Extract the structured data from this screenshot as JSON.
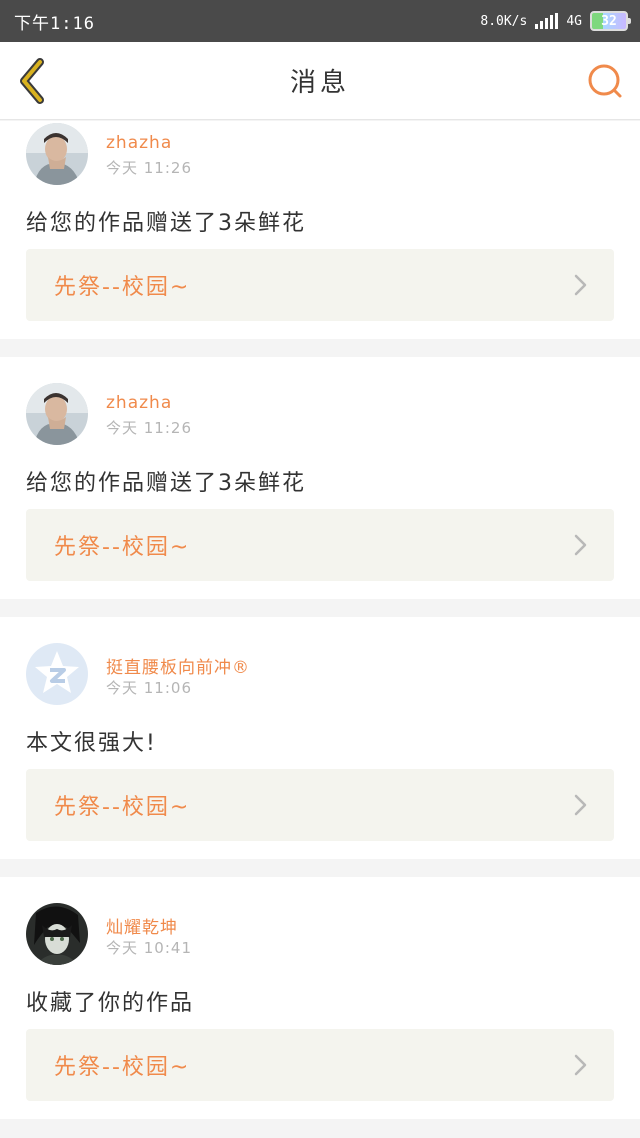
{
  "status_bar": {
    "time": "下午1:16",
    "network_speed": "8.0K/s",
    "network_type": "4G",
    "battery": "32"
  },
  "header": {
    "title": "消息",
    "back_icon": "chevron-left-icon",
    "search_icon": "search-icon"
  },
  "colors": {
    "accent": "#f08a4b",
    "back_icon": "#c9a41a"
  },
  "messages": [
    {
      "username": "zhazha",
      "time": "今天 11:26",
      "text": "给您的作品赠送了3朵鲜花",
      "work_title": "先祭--校园~"
    },
    {
      "username": "zhazha",
      "time": "今天 11:26",
      "text": "给您的作品赠送了3朵鲜花",
      "work_title": "先祭--校园~"
    },
    {
      "username": "挺直腰板向前冲®",
      "time": "今天 11:06",
      "text": "本文很强大!",
      "work_title": "先祭--校园~"
    },
    {
      "username": "灿耀乾坤",
      "time": "今天 10:41",
      "text": "收藏了你的作品",
      "work_title": "先祭--校园~"
    }
  ]
}
